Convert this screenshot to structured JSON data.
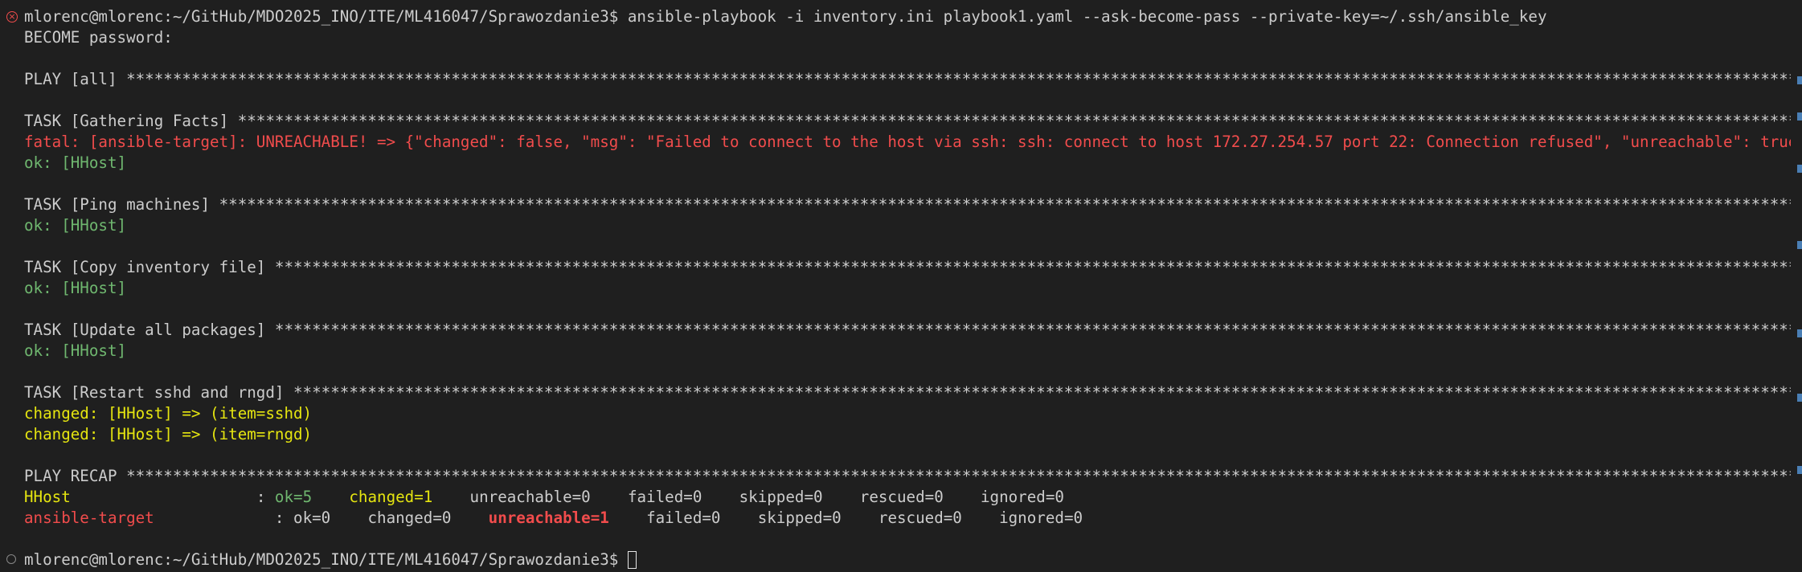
{
  "prompt1": "mlorenc@mlorenc:~/GitHub/MDO2025_INO/ITE/ML416047/Sprawozdanie3$ ",
  "command": "ansible-playbook -i inventory.ini playbook1.yaml --ask-become-pass --private-key=~/.ssh/ansible_key",
  "become_prompt": "BECOME password:",
  "play_header": "PLAY [all] ******************************************************************************************************************************************************************************************************************************",
  "task_gather": "TASK [Gathering Facts] ******************************************************************************************************************************************************************************************************************",
  "fatal_line": "fatal: [ansible-target]: UNREACHABLE! => {\"changed\": false, \"msg\": \"Failed to connect to the host via ssh: ssh: connect to host 172.27.254.57 port 22: Connection refused\", \"unreachable\": true}",
  "ok_hhost": "ok: [HHost]",
  "task_ping": "TASK [Ping machines] ********************************************************************************************************************************************************************************************************************",
  "task_copy": "TASK [Copy inventory file] **************************************************************************************************************************************************************************************************************",
  "task_update": "TASK [Update all packages] **************************************************************************************************************************************************************************************************************",
  "task_restart": "TASK [Restart sshd and rngd] ************************************************************************************************************************************************************************************************************",
  "changed_sshd": "changed: [HHost] => (item=sshd)",
  "changed_rngd": "changed: [HHost] => (item=rngd)",
  "recap_header": "PLAY RECAP **********************************************************************************************************************************************************************************************************************",
  "recap": [
    {
      "host": "HHost",
      "sep": ": ",
      "ok": "ok=5",
      "changed": "changed=1",
      "unreachable": "unreachable=0",
      "failed": "failed=0",
      "skipped": "skipped=0",
      "rescued": "rescued=0",
      "ignored": "ignored=0"
    },
    {
      "host": "ansible-target",
      "sep": ": ",
      "ok": "ok=0",
      "changed": "changed=0",
      "unreachable": "unreachable=1",
      "failed": "failed=0",
      "skipped": "skipped=0",
      "rescued": "rescued=0",
      "ignored": "ignored=0"
    }
  ],
  "prompt2": "mlorenc@mlorenc:~/GitHub/MDO2025_INO/ITE/ML416047/Sprawozdanie3$ ",
  "icons": {
    "error_mark": "close-circle-icon",
    "idle_mark": "circle-outline-icon",
    "cursor": "block-cursor"
  },
  "colors": {
    "background": "#1f1f1f",
    "text": "#cccccc",
    "ok": "#6fb76f",
    "error": "#f14c4c",
    "changed": "#e5e510",
    "scrollbar_marker": "#4a7fb5"
  }
}
